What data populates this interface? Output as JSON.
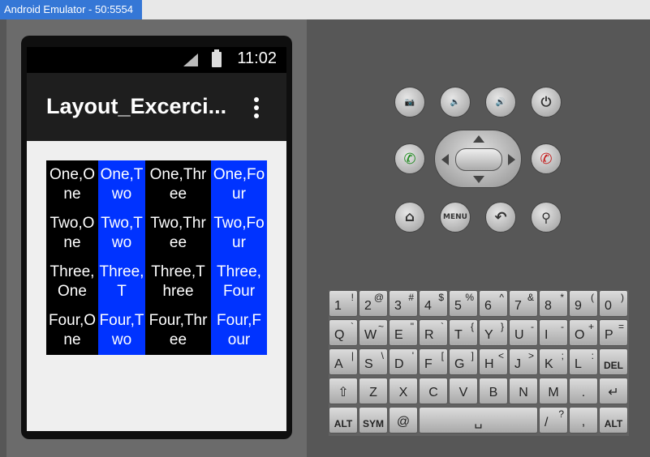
{
  "window": {
    "title": "Android Emulator - 50:5554"
  },
  "status_bar": {
    "time": "11:02"
  },
  "action_bar": {
    "title": "Layout_Excerci..."
  },
  "grid": {
    "rows": [
      [
        "One,One",
        "One,Two",
        "One,Three",
        "One,Four"
      ],
      [
        "Two,One",
        "Two,Two",
        "Two,Three",
        "Two,Four"
      ],
      [
        "Three,One",
        "Three,Two",
        "Three,Three",
        "Three,Four"
      ],
      [
        "Four,One",
        "Four,Two",
        "Four,Three",
        "Four,Four"
      ]
    ],
    "display": [
      [
        "One,O ne",
        "One,T wo",
        "One,Thr ee",
        "One,Fo ur"
      ],
      [
        "Two,O ne",
        "Two,T wo",
        "Two,Thr ee",
        "Two,Fo ur"
      ],
      [
        "Three, One",
        "Three,T wo",
        "Three,T hree",
        "Three, Four"
      ],
      [
        "Four,O ne",
        "Four,T wo",
        "Four,Thr ee",
        "Four,F our"
      ]
    ],
    "colors": {
      "dark": "#000000",
      "blue": "#0033ff"
    }
  },
  "hardware": {
    "menu_label": "MENU"
  },
  "keyboard": {
    "row1": [
      [
        "1",
        "!"
      ],
      [
        "2",
        "@"
      ],
      [
        "3",
        "#"
      ],
      [
        "4",
        "$"
      ],
      [
        "5",
        "%"
      ],
      [
        "6",
        "^"
      ],
      [
        "7",
        "&"
      ],
      [
        "8",
        "*"
      ],
      [
        "9",
        "("
      ],
      [
        "0",
        ")"
      ]
    ],
    "row2": [
      [
        "Q",
        "`"
      ],
      [
        "W",
        "~"
      ],
      [
        "E",
        "\""
      ],
      [
        "R",
        "`"
      ],
      [
        "T",
        "{"
      ],
      [
        "Y",
        "}"
      ],
      [
        "U",
        "-"
      ],
      [
        "I",
        "-"
      ],
      [
        "O",
        "+"
      ],
      [
        "P",
        "="
      ]
    ],
    "row3": [
      [
        "A",
        "|"
      ],
      [
        "S",
        "\\"
      ],
      [
        "D",
        "'"
      ],
      [
        "F",
        "["
      ],
      [
        "G",
        "]"
      ],
      [
        "H",
        "<"
      ],
      [
        "J",
        ">"
      ],
      [
        "K",
        ";"
      ],
      [
        "L",
        ":"
      ]
    ],
    "row4": [
      "Z",
      "X",
      "C",
      "V",
      "B",
      "N",
      "M",
      "."
    ],
    "row5": {
      "alt": "ALT",
      "sym": "SYM",
      "at": "@",
      "slash": "/",
      "question": "?",
      "comma": ",",
      "del": "DEL"
    }
  }
}
